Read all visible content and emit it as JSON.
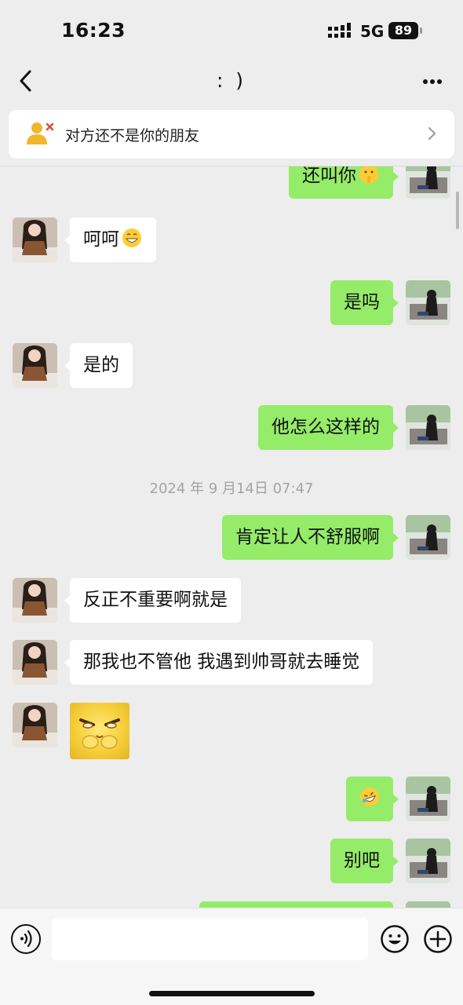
{
  "status_bar": {
    "time": "16:23",
    "network": "5G",
    "battery": "89"
  },
  "header": {
    "title": ": )",
    "back_icon": "chevron-left-icon",
    "more_icon": "more-dots-icon"
  },
  "banner": {
    "text": "对方还不是你的朋友",
    "icon": "user-x-icon",
    "chevron_icon": "chevron-right-icon"
  },
  "messages": [
    {
      "side": "right",
      "text": "还叫你",
      "emoji": "shushing-face-emoji"
    },
    {
      "side": "left",
      "text": "呵呵",
      "emoji": "grinning-face-emoji"
    },
    {
      "side": "right",
      "text": "是吗"
    },
    {
      "side": "left",
      "text": "是的"
    },
    {
      "side": "right",
      "text": "他怎么这样的"
    },
    {
      "type": "timestamp",
      "text": "2024 年 9 月14日 07:47"
    },
    {
      "side": "right",
      "text": "肯定让人不舒服啊"
    },
    {
      "side": "left",
      "text": "反正不重要啊就是"
    },
    {
      "side": "left",
      "text": "那我也不管他 我遇到帅哥就去睡觉"
    },
    {
      "side": "left",
      "type": "sticker",
      "sticker": "yellow-cat-sticker"
    },
    {
      "side": "right",
      "emoji": "rolling-laughing-emoji"
    },
    {
      "side": "right",
      "text": "别吧"
    },
    {
      "side": "right",
      "text": ""
    }
  ],
  "input_bar": {
    "placeholder": "",
    "voice_icon": "voice-icon",
    "emoji_icon": "emoji-face-icon",
    "plus_icon": "plus-circle-icon"
  },
  "colors": {
    "background": "#ededed",
    "my_bubble": "#95ec69",
    "their_bubble": "#ffffff",
    "timestamp": "#a3a3a3"
  }
}
